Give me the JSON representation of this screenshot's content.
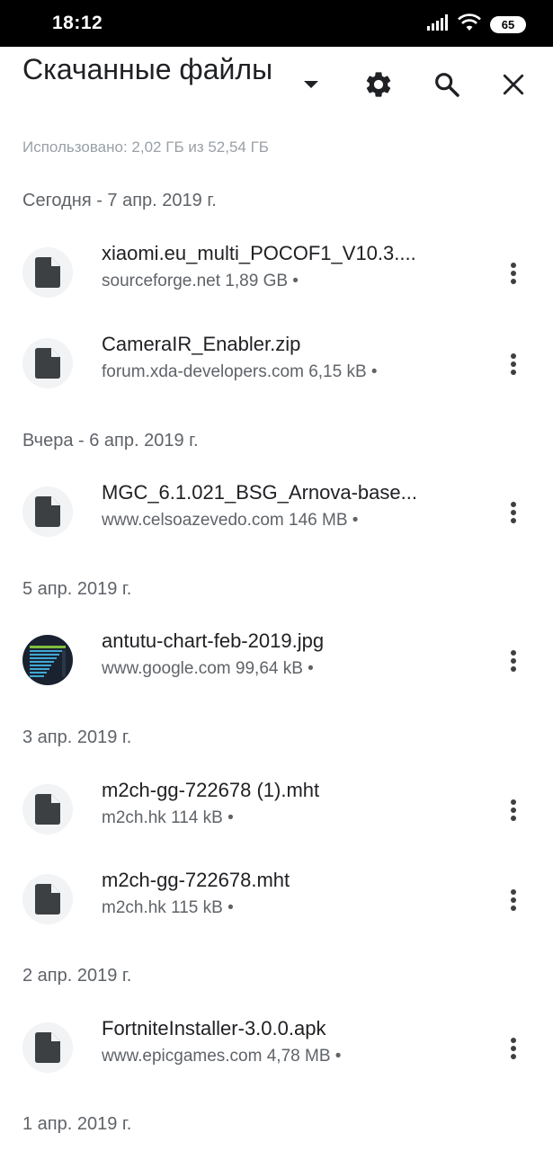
{
  "status_bar": {
    "time": "18:12",
    "battery": "65",
    "icons": [
      "signal-icon",
      "wifi-icon",
      "battery-icon"
    ]
  },
  "header": {
    "title": "Скачанные файлы",
    "usage": "Использовано: 2,02 ГБ из 52,54 ГБ",
    "icons": [
      "dropdown-arrow-icon",
      "settings-gear-icon",
      "search-icon",
      "close-icon"
    ]
  },
  "sections": [
    {
      "label": "Сегодня - 7 апр. 2019 г.",
      "files": [
        {
          "name": "xiaomi.eu_multi_POCOF1_V10.3....",
          "meta": "sourceforge.net 1,89 GB •",
          "icon": "document-icon"
        },
        {
          "name": "CameraIR_Enabler.zip",
          "meta": "forum.xda-developers.com 6,15 kB •",
          "icon": "document-icon"
        }
      ]
    },
    {
      "label": "Вчера - 6 апр. 2019 г.",
      "files": [
        {
          "name": "MGC_6.1.021_BSG_Arnova-base...",
          "meta": "www.celsoazevedo.com 146 MB •",
          "icon": "document-icon"
        }
      ]
    },
    {
      "label": "5 апр. 2019 г.",
      "files": [
        {
          "name": "antutu-chart-feb-2019.jpg",
          "meta": "www.google.com 99,64 kB •",
          "icon": "image-thumbnail"
        }
      ]
    },
    {
      "label": "3 апр. 2019 г.",
      "files": [
        {
          "name": "m2ch-gg-722678 (1).mht",
          "meta": "m2ch.hk 114 kB •",
          "icon": "document-icon"
        },
        {
          "name": "m2ch-gg-722678.mht",
          "meta": "m2ch.hk 115 kB •",
          "icon": "document-icon"
        }
      ]
    },
    {
      "label": "2 апр. 2019 г.",
      "files": [
        {
          "name": "FortniteInstaller-3.0.0.apk",
          "meta": "www.epicgames.com 4,78 MB •",
          "icon": "document-icon"
        }
      ]
    },
    {
      "label": "1 апр. 2019 г.",
      "files": []
    }
  ]
}
